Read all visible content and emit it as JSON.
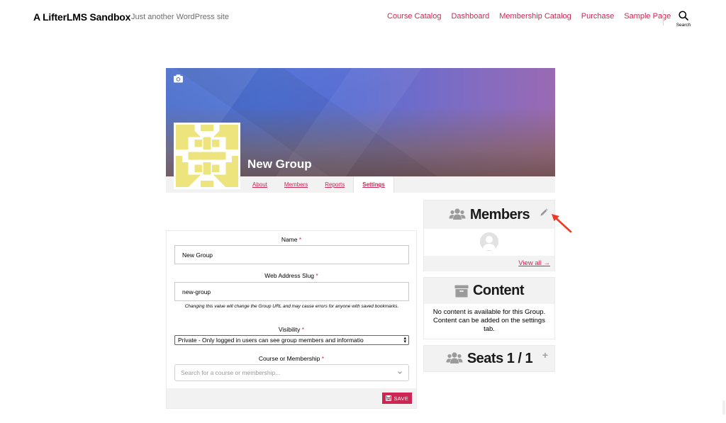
{
  "site": {
    "title": "A LifterLMS Sandbox",
    "description": "Just another WordPress site",
    "nav": [
      "Course Catalog",
      "Dashboard",
      "Membership Catalog",
      "Purchase",
      "Sample Page"
    ],
    "search_label": "Search"
  },
  "group": {
    "name": "New Group",
    "tabs": [
      {
        "label": "About",
        "active": false
      },
      {
        "label": "Members",
        "active": false
      },
      {
        "label": "Reports",
        "active": false
      },
      {
        "label": "Settings",
        "active": true
      }
    ]
  },
  "form": {
    "name_label": "Name",
    "name_value": "New Group",
    "slug_label": "Web Address Slug",
    "slug_value": "new-group",
    "slug_help": "Changing this value will change the Group URL and may cause errors for anyone with saved bookmarks.",
    "visibility_label": "Visibility",
    "visibility_value": "Private - Only logged in users can see group members and informatio",
    "course_label": "Course or Membership",
    "course_placeholder": "Search for a course or membership...",
    "required_mark": "*",
    "save_label": "SAVE"
  },
  "widgets": {
    "members_title": "Members",
    "view_all": "View all →",
    "content_title": "Content",
    "content_text": "No content is available for this Group. Content can be added on the settings tab.",
    "seats_title": "Seats 1 / 1",
    "seats_plus": "+"
  },
  "colors": {
    "accent": "#cd2653",
    "annotation_arrow": "#ef3b24"
  },
  "icons": {
    "search": "search-icon",
    "camera": "camera-icon",
    "users": "users-icon",
    "edit": "pencil-icon",
    "archive": "archive-icon",
    "save": "floppy-icon",
    "chevron": "chevron-down-icon"
  }
}
